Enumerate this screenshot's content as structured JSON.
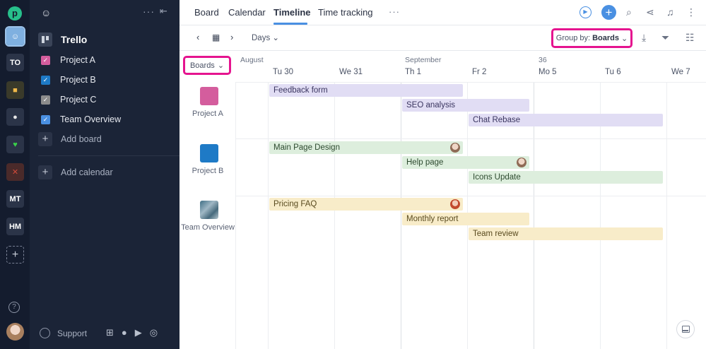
{
  "rail": {
    "workspaces": [
      {
        "label": "",
        "icon": "emoji-workspace-icon"
      },
      {
        "label": "TO"
      },
      {
        "label": "",
        "icon": "cat-icon"
      },
      {
        "label": "",
        "icon": "eye-icon"
      },
      {
        "label": "",
        "icon": "heart-icon"
      },
      {
        "label": "",
        "icon": "pattern-icon"
      },
      {
        "label": "MT"
      },
      {
        "label": "HM"
      }
    ],
    "add": "+",
    "help": "?"
  },
  "sidebar": {
    "trello_label": "Trello",
    "boards": [
      {
        "label": "Project A",
        "color": "#d45d9d"
      },
      {
        "label": "Project B",
        "color": "#1e7ac6"
      },
      {
        "label": "Project C",
        "color": "#8c8c8c"
      },
      {
        "label": "Team Overview",
        "color": "#4a90e2"
      }
    ],
    "add_board": "Add board",
    "add_calendar": "Add calendar",
    "support": "Support"
  },
  "topbar": {
    "tabs": [
      {
        "label": "Board"
      },
      {
        "label": "Calendar"
      },
      {
        "label": "Timeline",
        "active": true
      },
      {
        "label": "Time tracking"
      }
    ],
    "more": "···",
    "add": "+"
  },
  "toolbar": {
    "view_mode": "Days",
    "group_by_label": "Group by:",
    "group_by_value": "Boards"
  },
  "timeline": {
    "selector": "Boards",
    "months": [
      {
        "label": "August"
      },
      {
        "label": "September"
      },
      {
        "label": "36"
      }
    ],
    "days": [
      "Tu 30",
      "We 31",
      "Th 1",
      "Fr 2",
      "Mo 5",
      "Tu 6",
      "We 7"
    ],
    "rows": [
      {
        "label": "Project A",
        "color": "#d45d9d",
        "tasks": [
          {
            "label": "Feedback form",
            "start": 0,
            "span": 3
          },
          {
            "label": "SEO analysis",
            "start": 2,
            "span": 2
          },
          {
            "label": "Chat Rebase",
            "start": 3,
            "span": 3
          }
        ]
      },
      {
        "label": "Project B",
        "color": "#1e7ac6",
        "tasks": [
          {
            "label": "Main Page Design",
            "start": 0,
            "span": 3,
            "avatar": true
          },
          {
            "label": "Help page",
            "start": 2,
            "span": 2,
            "avatar": true
          },
          {
            "label": "Icons Update",
            "start": 3,
            "span": 3
          }
        ]
      },
      {
        "label": "Team Overview",
        "color": "#5c7f93",
        "tasks": [
          {
            "label": "Pricing FAQ",
            "start": 0,
            "span": 3,
            "avatar": true
          },
          {
            "label": "Monthly report",
            "start": 2,
            "span": 2
          },
          {
            "label": "Team review",
            "start": 3,
            "span": 3
          }
        ]
      }
    ]
  }
}
